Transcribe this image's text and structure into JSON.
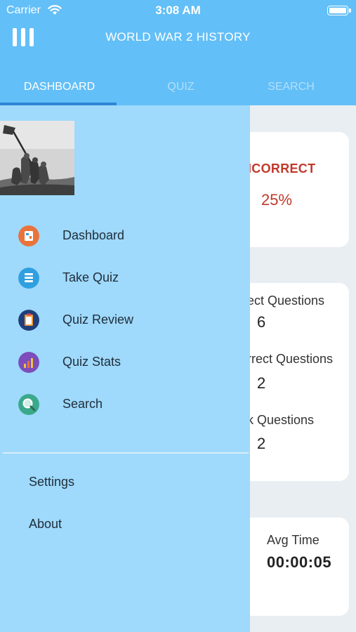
{
  "status_bar": {
    "carrier": "Carrier",
    "time": "3:08 AM"
  },
  "header": {
    "title": "WORLD WAR 2 HISTORY"
  },
  "tabs": [
    {
      "label": "DASHBOARD",
      "active": true
    },
    {
      "label": "QUIZ",
      "active": false
    },
    {
      "label": "SEARCH",
      "active": false
    }
  ],
  "dashboard": {
    "incorrect_label": "ICORRECT",
    "incorrect_value": "25%",
    "stats": [
      {
        "label": "ect Questions",
        "value": "6"
      },
      {
        "label": "rrect Questions",
        "value": "2"
      },
      {
        "label": "k Questions",
        "value": "2"
      }
    ],
    "avg_time_label": "Avg Time",
    "avg_time_value": "00:00:05"
  },
  "drawer": {
    "menu": [
      {
        "label": "Dashboard",
        "icon": "dashboard-icon",
        "color": "#e8743b"
      },
      {
        "label": "Take Quiz",
        "icon": "take-quiz-icon",
        "color": "#2f9fe0"
      },
      {
        "label": "Quiz Review",
        "icon": "quiz-review-icon",
        "color": "#1f3f7a"
      },
      {
        "label": "Quiz Stats",
        "icon": "quiz-stats-icon",
        "color": "#7c4dbb"
      },
      {
        "label": "Search",
        "icon": "search-icon",
        "color": "#3aa98b"
      }
    ],
    "secondary": [
      {
        "label": "Settings"
      },
      {
        "label": "About"
      }
    ]
  },
  "colors": {
    "header": "#63bff7",
    "drawer": "#9fd9fb",
    "incorrect": "#c0392b",
    "tab_indicator": "#2f86d8"
  }
}
